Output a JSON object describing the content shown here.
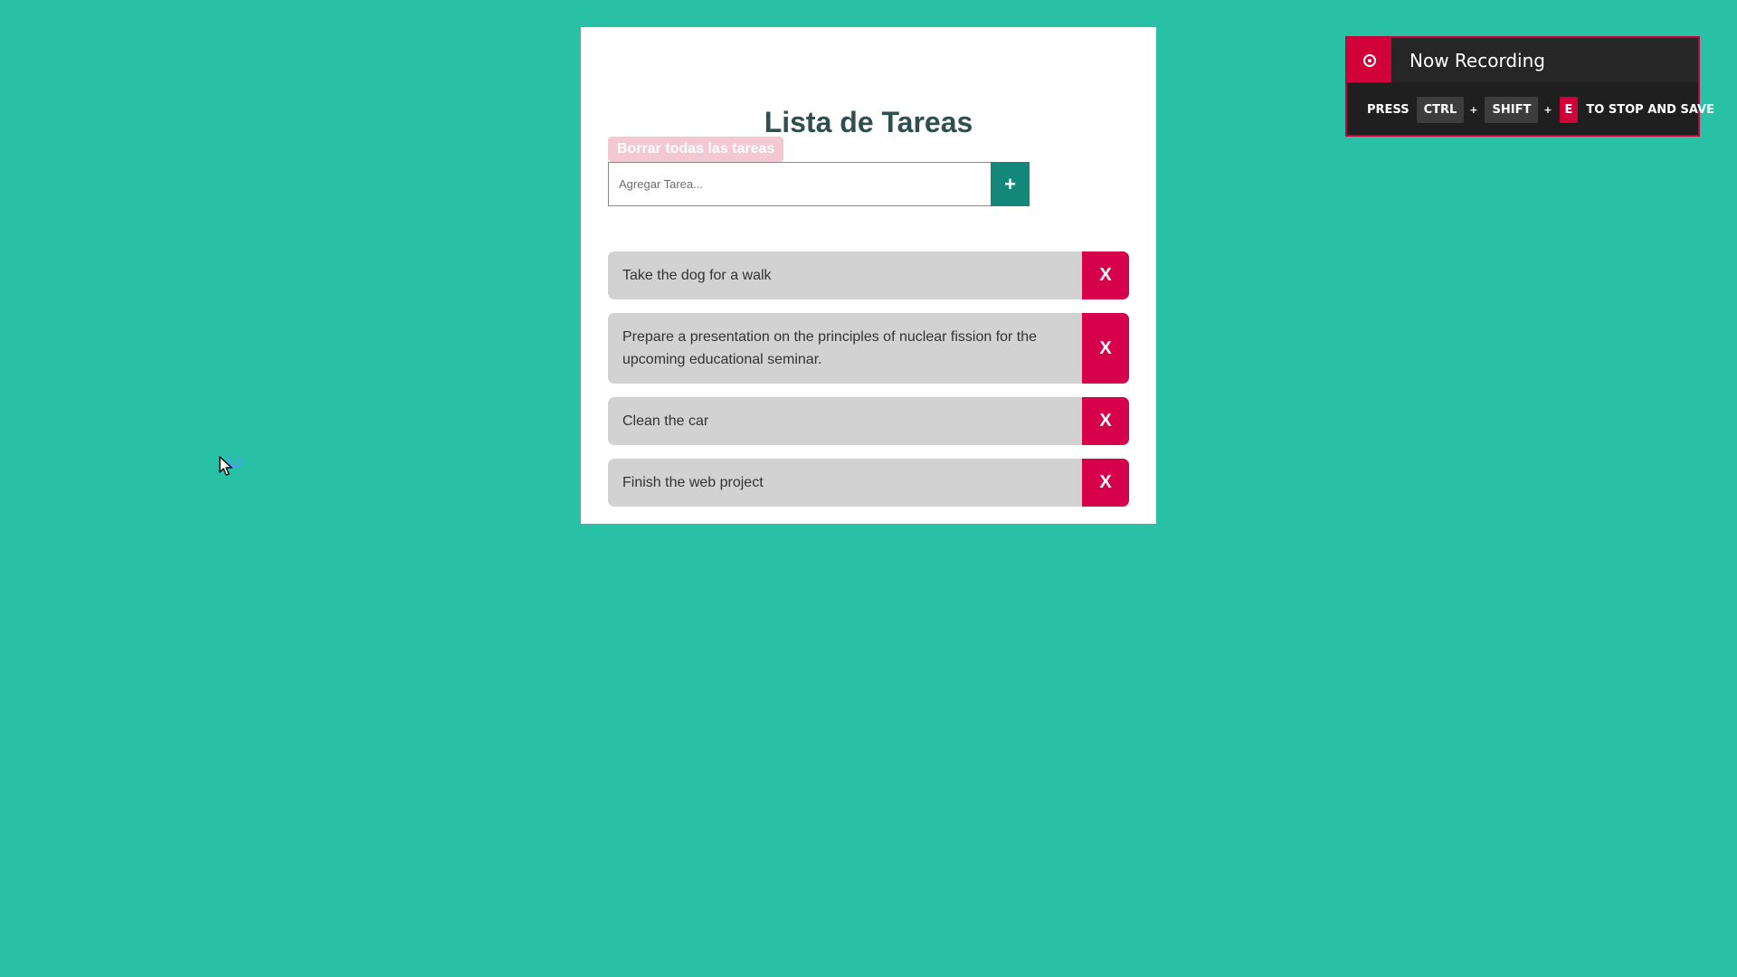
{
  "todo": {
    "title": "Lista de Tareas",
    "clear_all_label": "Borrar todas las tareas",
    "input_value": "",
    "input_placeholder": "Agregar Tarea...",
    "add_label": "+",
    "tasks": [
      {
        "text": "Take the dog for a walk",
        "delete_label": "X"
      },
      {
        "text": "Prepare a presentation on the principles of nuclear fission for the upcoming educational seminar.",
        "delete_label": "X"
      },
      {
        "text": "Clean the car",
        "delete_label": "X"
      },
      {
        "text": "Finish the web project",
        "delete_label": "X"
      }
    ]
  },
  "recorder": {
    "title": "Now Recording",
    "press_label": "PRESS",
    "key_ctrl": "CTRL",
    "plus": "+",
    "key_shift": "SHIFT",
    "key_e": "E",
    "stop_save_label": "TO STOP AND SAVE",
    "icon": "record-icon"
  },
  "cursor": {
    "icon": "mouse-pointer-icon",
    "busy_icon": "loading-ring-icon"
  },
  "colors": {
    "background": "#28c1a6",
    "card": "#ffffff",
    "title": "#2f4f4f",
    "add_button": "#13877a",
    "task_background": "#d2d2d2",
    "delete_button": "#d6004b",
    "clear_button": "#f4c8d2",
    "recording_red": "#d20039",
    "recording_dark": "#1f1f1f"
  }
}
